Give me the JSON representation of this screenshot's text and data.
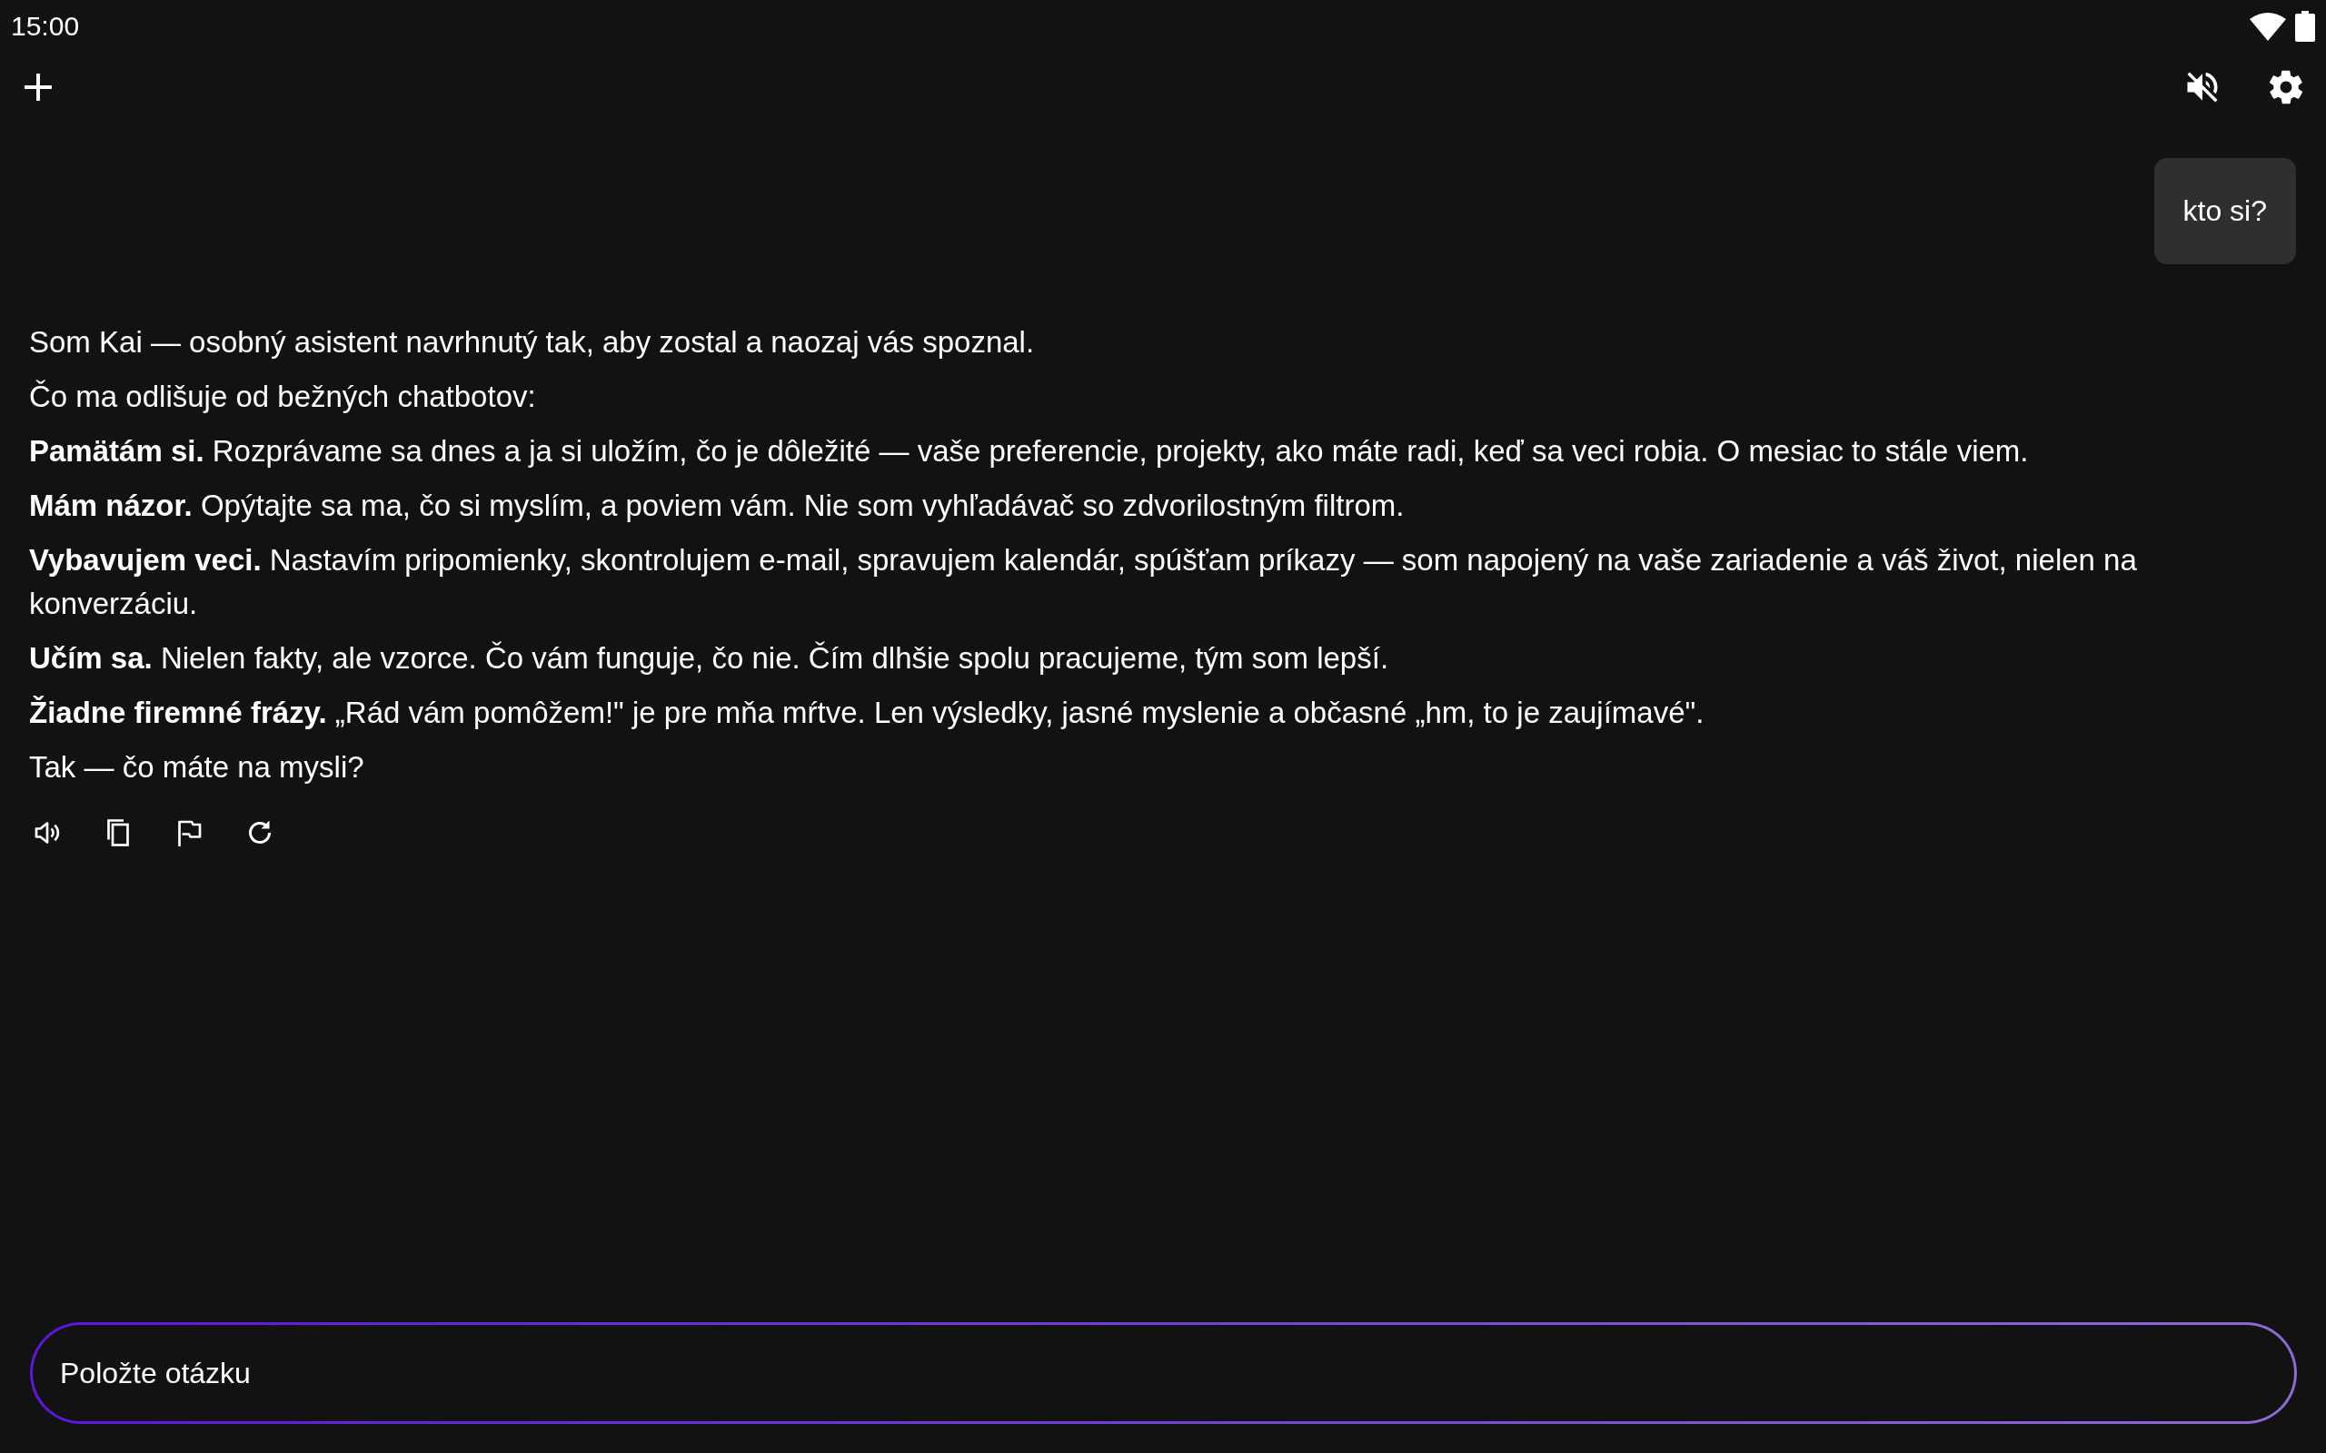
{
  "status_bar": {
    "time": "15:00"
  },
  "user_message": {
    "text": "kto si?"
  },
  "assistant_message": {
    "paragraphs": [
      "Som Kai — osobný asistent navrhnutý tak, aby zostal a naozaj vás spoznal.",
      "Čo ma odlišuje od bežných chatbotov:",
      "**Pamätám si.** Rozprávame sa dnes a ja si uložím, čo je dôležité — vaše preferencie, projekty, ako máte radi, keď sa veci robia. O mesiac to stále viem.",
      "**Mám názor.** Opýtajte sa ma, čo si myslím, a poviem vám. Nie som vyhľadávač so zdvorilostným filtrom.",
      "**Vybavujem veci.** Nastavím pripomienky, skontrolujem e-mail, spravujem kalendár, spúšťam príkazy — som napojený na vaše zariadenie a váš život, nielen na konverzáciu.",
      "**Učím sa.** Nielen fakty, ale vzorce. Čo vám funguje, čo nie. Čím dlhšie spolu pracujeme, tým som lepší.",
      "**Žiadne firemné frázy.** „Rád vám pomôžem!\" je pre mňa mŕtve. Len výsledky, jasné myslenie a občasné „hm, to je zaujímavé\".",
      "Tak — čo máte na mysli?"
    ]
  },
  "input": {
    "placeholder": "Položte otázku"
  }
}
